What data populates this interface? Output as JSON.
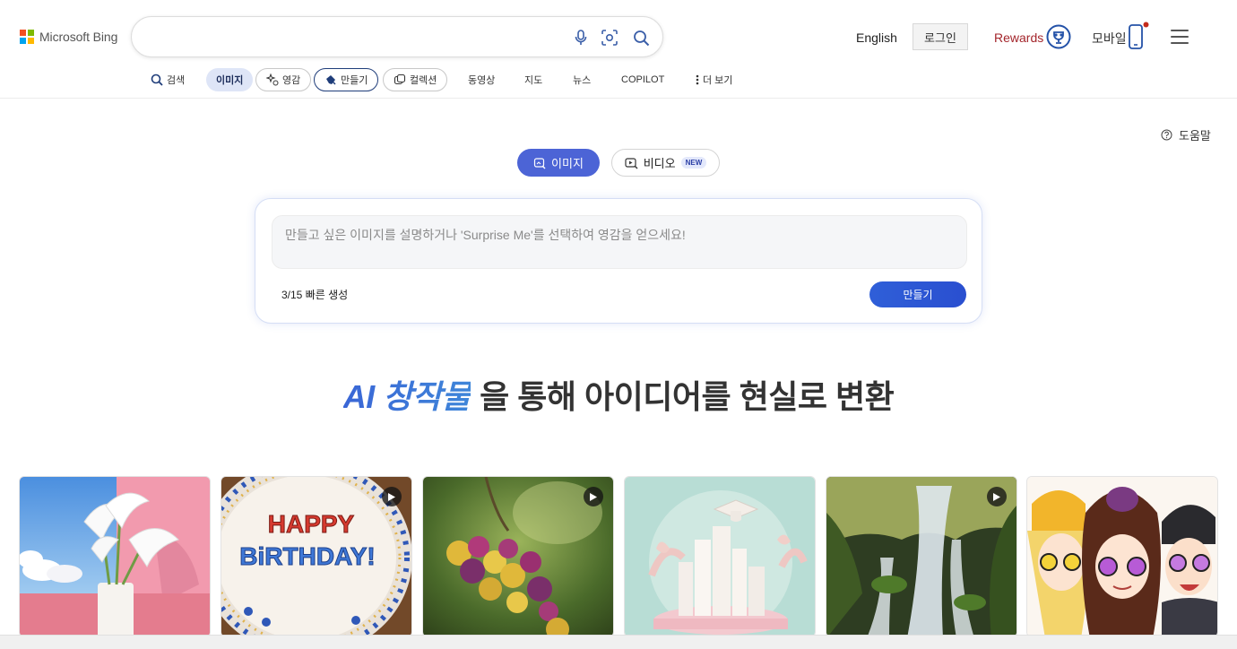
{
  "header": {
    "logo_text": "Microsoft Bing",
    "search": {
      "value": "",
      "placeholder": ""
    },
    "language": "English",
    "login": "로그인",
    "rewards": "Rewards",
    "mobile": "모바일"
  },
  "nav": {
    "items": [
      {
        "label": "검색"
      },
      {
        "label": "이미지"
      },
      {
        "label": "영감"
      },
      {
        "label": "만들기"
      },
      {
        "label": "컬렉션"
      },
      {
        "label": "동영상"
      },
      {
        "label": "지도"
      },
      {
        "label": "뉴스"
      },
      {
        "label": "COPILOT"
      },
      {
        "label": "더 보기"
      }
    ]
  },
  "main": {
    "help": "도움말",
    "tabs": [
      {
        "label": "이미지"
      },
      {
        "label": "비디오",
        "badge": "NEW"
      }
    ],
    "prompt": {
      "value": "",
      "placeholder": "만들고 싶은 이미지를 설명하거나 'Surprise Me'를 선택하여 영감을 얻으세요!"
    },
    "boosts": "3/15 빠른 생성",
    "create_button": "만들기",
    "headline": {
      "accent": "AI 창작물",
      "rest": "을 통해 아이디어를 현실로 변환"
    }
  },
  "gallery": {
    "tiles": [
      {
        "subject": "calla-lilies",
        "video": false
      },
      {
        "subject": "birthday-cake",
        "video": true,
        "text": [
          "HAPPY",
          "BiRTHDAY!"
        ]
      },
      {
        "subject": "flower-cluster",
        "video": true
      },
      {
        "subject": "paper-city-graduation",
        "video": false
      },
      {
        "subject": "waterfall",
        "video": true
      },
      {
        "subject": "cartoon-friends",
        "video": false
      }
    ]
  },
  "colors": {
    "accent": "#4c64d6",
    "rewards": "#a4262c",
    "headline_accent": "#3d6ed8"
  }
}
